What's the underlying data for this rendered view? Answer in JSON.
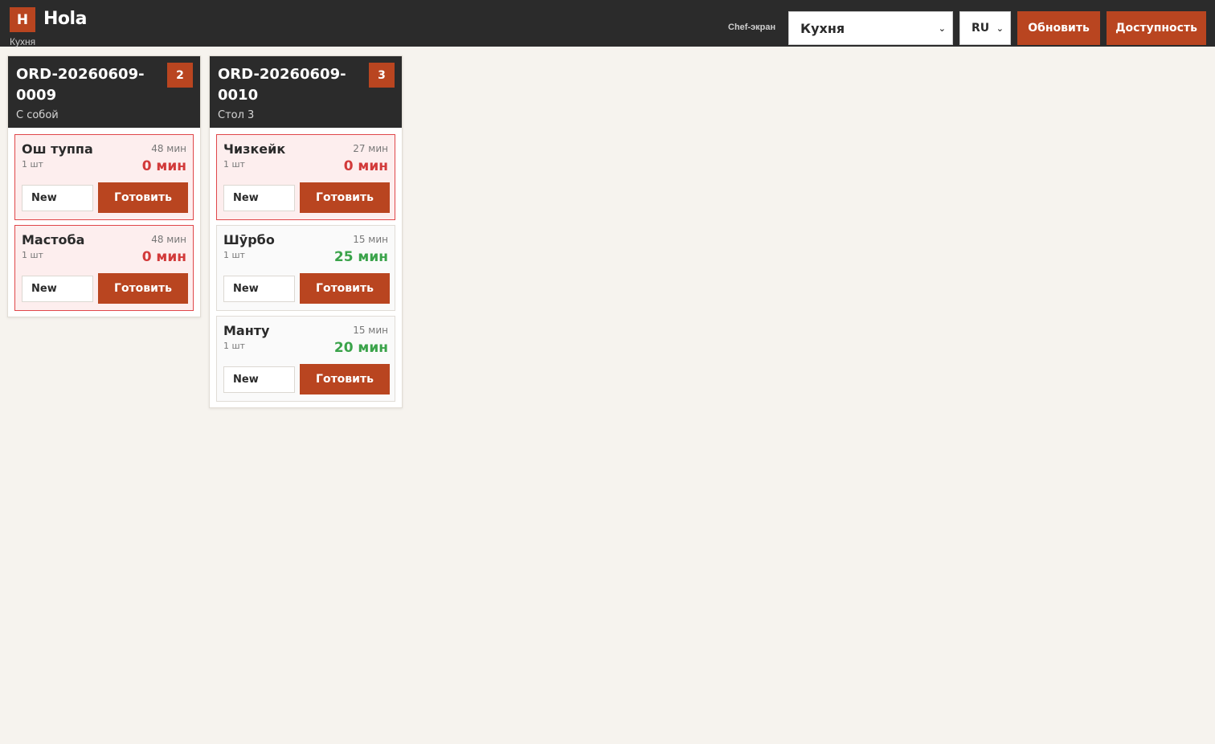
{
  "header": {
    "logo_letter": "H",
    "app_name": "Hola",
    "station_subtitle": "Кухня",
    "chef_label": "Chef-экран",
    "station_select": "Кухня",
    "lang_select": "RU",
    "refresh_label": "Обновить",
    "availability_label": "Доступность"
  },
  "colors": {
    "accent": "#b94520",
    "topbar": "#2b2b2b",
    "late_red": "#d23a3a",
    "ok_green": "#3aa34a",
    "background": "#f6f3ee"
  },
  "orders": [
    {
      "number": "ORD-20260609-0009",
      "type": "С собой",
      "count": "2",
      "items": [
        {
          "name": "Ош туппа",
          "qty": "1 шт",
          "estimate": "48 мин",
          "remaining": "0 мин",
          "late": true,
          "status": "New",
          "action": "Готовить"
        },
        {
          "name": "Мастоба",
          "qty": "1 шт",
          "estimate": "48 мин",
          "remaining": "0 мин",
          "late": true,
          "status": "New",
          "action": "Готовить"
        }
      ]
    },
    {
      "number": "ORD-20260609-0010",
      "type": "Стол 3",
      "count": "3",
      "items": [
        {
          "name": "Чизкейк",
          "qty": "1 шт",
          "estimate": "27 мин",
          "remaining": "0 мин",
          "late": true,
          "status": "New",
          "action": "Готовить"
        },
        {
          "name": "Шӯрбо",
          "qty": "1 шт",
          "estimate": "15 мин",
          "remaining": "25 мин",
          "late": false,
          "status": "New",
          "action": "Готовить"
        },
        {
          "name": "Манту",
          "qty": "1 шт",
          "estimate": "15 мин",
          "remaining": "20 мин",
          "late": false,
          "status": "New",
          "action": "Готовить"
        }
      ]
    }
  ]
}
